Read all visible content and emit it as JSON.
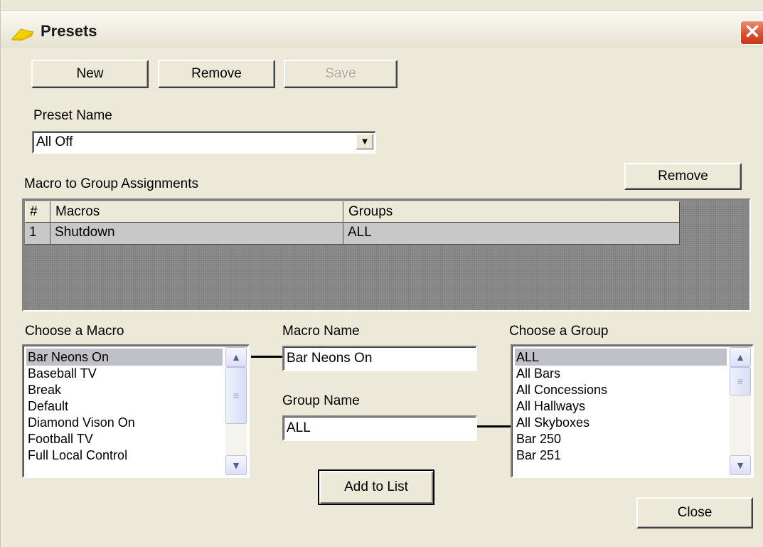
{
  "window": {
    "title": "Presets",
    "close_glyph": "✕",
    "icon": "folder-arrow-icon"
  },
  "toolbar": {
    "new_label": "New",
    "remove_label": "Remove",
    "save_label": "Save"
  },
  "preset": {
    "label": "Preset Name",
    "value": "All Off",
    "dropdown_glyph": "▼"
  },
  "assignments": {
    "label": "Macro to Group Assignments",
    "remove_label": "Remove",
    "columns": [
      "#",
      "Macros",
      "Groups"
    ],
    "rows": [
      {
        "num": "1",
        "macro": "Shutdown",
        "group": "ALL"
      }
    ]
  },
  "macro_list": {
    "label": "Choose a Macro",
    "items": [
      "Bar Neons On",
      "Baseball TV",
      "Break",
      "Default",
      "Diamond Vison On",
      "Football TV",
      "Full Local Control"
    ],
    "selected": "Bar Neons On"
  },
  "macro_name": {
    "label": "Macro Name",
    "value": "Bar Neons On"
  },
  "group_name": {
    "label": "Group Name",
    "value": "ALL"
  },
  "group_list": {
    "label": "Choose a Group",
    "items": [
      "ALL",
      "All Bars",
      "All Concessions",
      "All Hallways",
      "All Skyboxes",
      "Bar 250",
      "Bar 251"
    ],
    "selected": "ALL"
  },
  "actions": {
    "add_label": "Add to List",
    "close_label": "Close"
  },
  "scroll": {
    "up_glyph": "▲",
    "down_glyph": "▼",
    "grip_glyph": "≡"
  }
}
